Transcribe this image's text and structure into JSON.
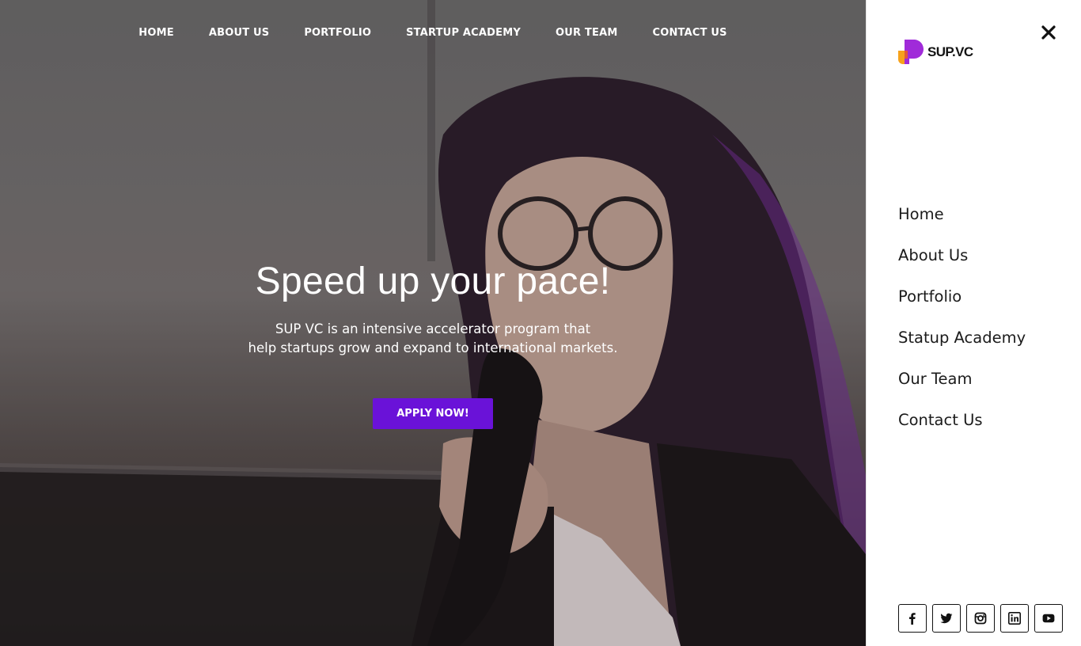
{
  "top_nav": {
    "items": [
      {
        "label": "HOME"
      },
      {
        "label": "ABOUT US"
      },
      {
        "label": "PORTFOLIO"
      },
      {
        "label": "STARTUP ACADEMY"
      },
      {
        "label": "OUR TEAM"
      },
      {
        "label": "CONTACT US"
      }
    ]
  },
  "hero": {
    "title": "Speed up your pace!",
    "subtitle_line1": "SUP VC is an intensive accelerator program that",
    "subtitle_line2": "help startups grow and expand to international markets.",
    "cta_label": "APPLY NOW!",
    "background_image": "woman-with-glasses-speaking-into-microphone"
  },
  "side_panel": {
    "logo_text": "SUP.VC",
    "close_icon": "close-icon",
    "menu": [
      {
        "label": "Home"
      },
      {
        "label": "About Us"
      },
      {
        "label": "Portfolio"
      },
      {
        "label": "Statup Academy"
      },
      {
        "label": "Our Team"
      },
      {
        "label": "Contact Us"
      }
    ],
    "socials": [
      {
        "icon": "facebook-icon"
      },
      {
        "icon": "twitter-icon"
      },
      {
        "icon": "instagram-icon"
      },
      {
        "icon": "linkedin-icon"
      },
      {
        "icon": "youtube-icon"
      }
    ]
  },
  "colors": {
    "accent": "#6a12d8",
    "logo_orange": "#f7a21b",
    "logo_purple": "#a02bd9",
    "panel_text": "#1b1b1b"
  }
}
